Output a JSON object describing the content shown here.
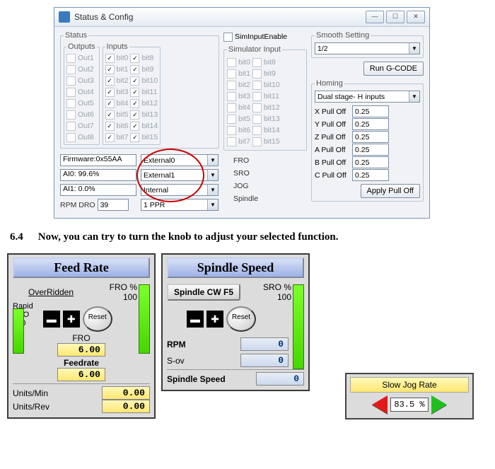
{
  "window": {
    "title": "Status & Config",
    "min": "—",
    "max": "☐",
    "close": "✕"
  },
  "status": {
    "legend": "Status",
    "outputs_legend": "Outputs",
    "inputs_legend": "Inputs",
    "outs": [
      "Out1",
      "Out2",
      "Out3",
      "Out4",
      "Out5",
      "Out6",
      "Out7",
      "Out8"
    ],
    "inL": [
      "bit0",
      "bit1",
      "bit2",
      "bit3",
      "bit4",
      "bit5",
      "bit6",
      "bit7"
    ],
    "inR": [
      "bit8",
      "bit9",
      "bit10",
      "bit11",
      "bit12",
      "bit13",
      "bit14",
      "bit15"
    ]
  },
  "sim": {
    "enable": "SimInputEnable",
    "legend": "Simulator Input",
    "left": [
      "bit0",
      "bit1",
      "bit2",
      "bit3",
      "bit4",
      "bit5",
      "bit6",
      "bit7"
    ],
    "right": [
      "bit8",
      "bit9",
      "bit10",
      "bit11",
      "bit12",
      "bit13",
      "bit14",
      "bit15"
    ]
  },
  "smooth": {
    "legend": "Smooth Setting",
    "value": "1/2"
  },
  "runbtn": "Run G-CODE",
  "homing": {
    "legend": "Homing",
    "mode": "Dual stage- H inputs",
    "fields": [
      {
        "label": "X Pull Off",
        "val": "0.25"
      },
      {
        "label": "Y Pull Off",
        "val": "0.25"
      },
      {
        "label": "Z Pull Off",
        "val": "0.25"
      },
      {
        "label": "A Pull Off",
        "val": "0.25"
      },
      {
        "label": "B Pull Off",
        "val": "0.25"
      },
      {
        "label": "C Pull Off",
        "val": "0.25"
      }
    ],
    "apply": "Apply Pull Off"
  },
  "bottom": {
    "fw_label": "Firmware:0x55AA",
    "ai0_label": "AI0: 99.6%",
    "ai1_label": "AI1: 0.0%",
    "rpm_label": "RPM DRO",
    "rpm_val": "39",
    "drop0": "External0",
    "drop1": "External1",
    "drop2": "Internal",
    "drop3": "1 PPR",
    "r0": "FRO",
    "r1": "SRO",
    "r2": "JOG",
    "r3": "Spindle"
  },
  "caption": {
    "num": "6.4",
    "text": "Now, you can try to turn the knob to adjust your selected function."
  },
  "feed": {
    "title": "Feed Rate",
    "override": "OverRidden",
    "fro_pct_lbl": "FRO %",
    "fro_pct": "100",
    "rapid_lbl": "Rapid\nFRO",
    "rapid_val": "100",
    "minus": "▬",
    "plus": "✚",
    "reset": "Reset",
    "fro_lbl": "FRO",
    "fro_val": "6.00",
    "feed_lbl": "Feedrate",
    "feed_val": "6.00",
    "um_lbl": "Units/Min",
    "um_val": "0.00",
    "ur_lbl": "Units/Rev",
    "ur_val": "0.00"
  },
  "spindle": {
    "title": "Spindle Speed",
    "btn": "Spindle CW F5",
    "sro_pct_lbl": "SRO %",
    "sro_pct": "100",
    "minus": "▬",
    "plus": "✚",
    "reset": "Reset",
    "rpm_lbl": "RPM",
    "rpm_val": "0",
    "sov_lbl": "S-ov",
    "sov_val": "0",
    "ss_lbl": "Spindle Speed",
    "ss_val": "0"
  },
  "jog": {
    "title": "Slow Jog Rate",
    "value": "83.5",
    "pct": "%"
  }
}
